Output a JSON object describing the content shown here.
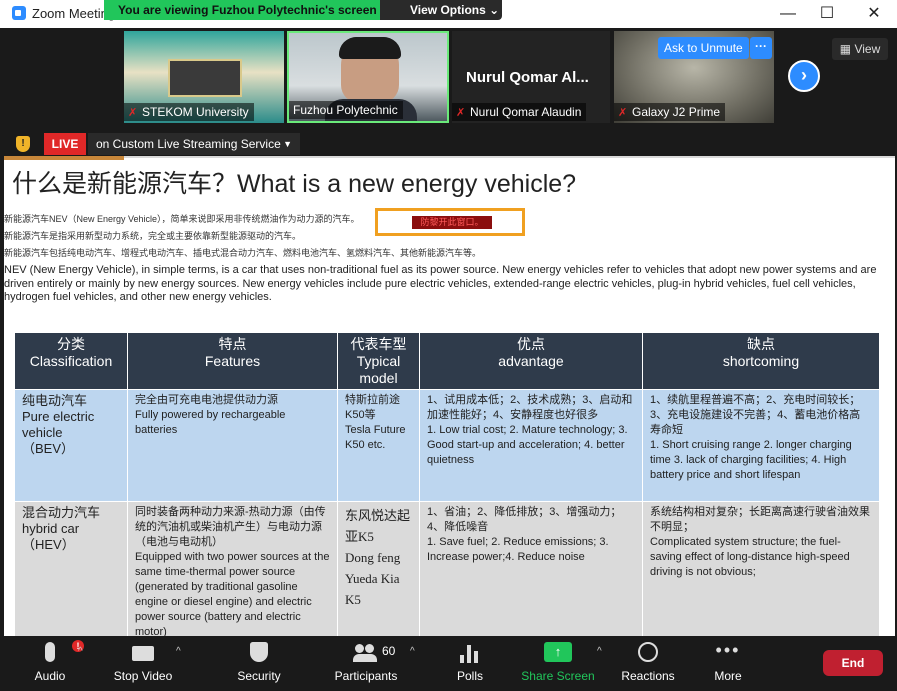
{
  "app": {
    "title": "Zoom Meeting",
    "banner_text": "You are viewing Fuzhou Polytechnic's screen",
    "banner_options": "View Options"
  },
  "window_controls": {
    "minimize": "—",
    "maximize": "☐",
    "close": "✕"
  },
  "participants_strip": {
    "thumbnails": [
      {
        "name": "STEKOM University",
        "muted": true
      },
      {
        "name": "Fuzhou Polytechnic",
        "muted": false,
        "active_speaker": true
      },
      {
        "name": "Nurul Qomar Alaudin",
        "display_name": "Nurul Qomar Al...",
        "muted": true
      },
      {
        "name": "Galaxy J2 Prime",
        "muted": true
      }
    ],
    "ask_to_unmute": "Ask to Unmute",
    "more_label": "···",
    "next_label": "›",
    "view_label": "View"
  },
  "live": {
    "badge": "LIVE",
    "service": "on Custom Live Streaming Service"
  },
  "slide": {
    "title": "什么是新能源汽车？What is a new energy vehicle?",
    "cn_lines": [
      "新能源汽车NEV（New Energy Vehicle），简单来说即采用非传统燃油作为动力源的汽车。",
      "新能源汽车是指采用新型动力系统，完全或主要依靠新型能源驱动的汽车。",
      "新能源汽车包括纯电动汽车、增程式电动汽车、插电式混合动力汽车、燃料电池汽车、氢燃料汽车、其他新能源汽车等。"
    ],
    "stamp_text": "防黎开此窗口。",
    "en_paragraph": "NEV (New Energy Vehicle), in simple terms, is a car that uses non-traditional fuel as its power source. New energy vehicles refer to vehicles that adopt new power systems and are driven entirely or mainly by new energy sources. New energy vehicles include pure electric vehicles, extended-range electric vehicles, plug-in hybrid vehicles, fuel cell vehicles, hydrogen fuel vehicles, and other new energy vehicles.",
    "table": {
      "headers": [
        {
          "cn": "分类",
          "en": "Classification"
        },
        {
          "cn": "特点",
          "en": "Features"
        },
        {
          "cn": "代表车型",
          "en": "Typical model"
        },
        {
          "cn": "优点",
          "en": "advantage"
        },
        {
          "cn": "缺点",
          "en": "shortcoming"
        }
      ],
      "rows": [
        {
          "class_cn": "纯电动汽车",
          "class_en": "Pure electric vehicle",
          "class_abbr": "（BEV）",
          "features_cn": "完全由可充电电池提供动力源",
          "features_en": "Fully powered by rechargeable batteries",
          "model_cn": "特斯拉前途K50等",
          "model_en": "Tesla Future K50 etc.",
          "adv_cn": "1、试用成本低；2、技术成熟；3、启动和加速性能好；4、安静程度也好很多",
          "adv_en": "1. Low trial cost; 2. Mature technology; 3. Good start-up and acceleration; 4. better quietness",
          "short_cn": "1、续航里程普遍不高；2、充电时间较长；3、充电设施建设不完善；4、蓄电池价格高 寿命短",
          "short_en": "1. Short cruising range 2. longer charging time 3. lack of charging facilities; 4. High battery price and short lifespan"
        },
        {
          "class_cn": "混合动力汽车",
          "class_en": "hybrid car",
          "class_abbr": "（HEV）",
          "features_cn": "同时装备两种动力来源-热动力源（由传统的汽油机或柴油机产生）与电动力源（电池与电动机）",
          "features_en": "Equipped with two power sources at the same time-thermal power source (generated by traditional gasoline engine or diesel engine) and electric power source (battery and electric motor)",
          "model_cn": "东风悦达起亚K5",
          "model_en": "Dong feng Yueda Kia K5",
          "adv_cn": "1、省油；2、降低排放；3、增强动力；4、降低噪音",
          "adv_en": "1. Save fuel; 2. Reduce emissions; 3. Increase power;4. Reduce noise",
          "short_cn": "系统结构相对复杂；长距离高速行驶省油效果不明显；",
          "short_en": "Complicated system structure; the fuel-saving effect of long-distance high-speed driving is not obvious;"
        }
      ]
    }
  },
  "toolbar": {
    "audio": "Audio",
    "audio_badge": "!",
    "stop_video": "Stop Video",
    "security": "Security",
    "participants": "Participants",
    "participants_count": "60",
    "polls": "Polls",
    "share_screen": "Share Screen",
    "reactions": "Reactions",
    "more": "More",
    "end": "End"
  },
  "colors": {
    "zoom_blue": "#2d8cff",
    "banner_green": "#21c65b",
    "live_red": "#e02828",
    "end_red": "#c02030",
    "table_header": "#2f3b4b",
    "row_blue": "#bdd6ef",
    "row_gray": "#dadada"
  }
}
